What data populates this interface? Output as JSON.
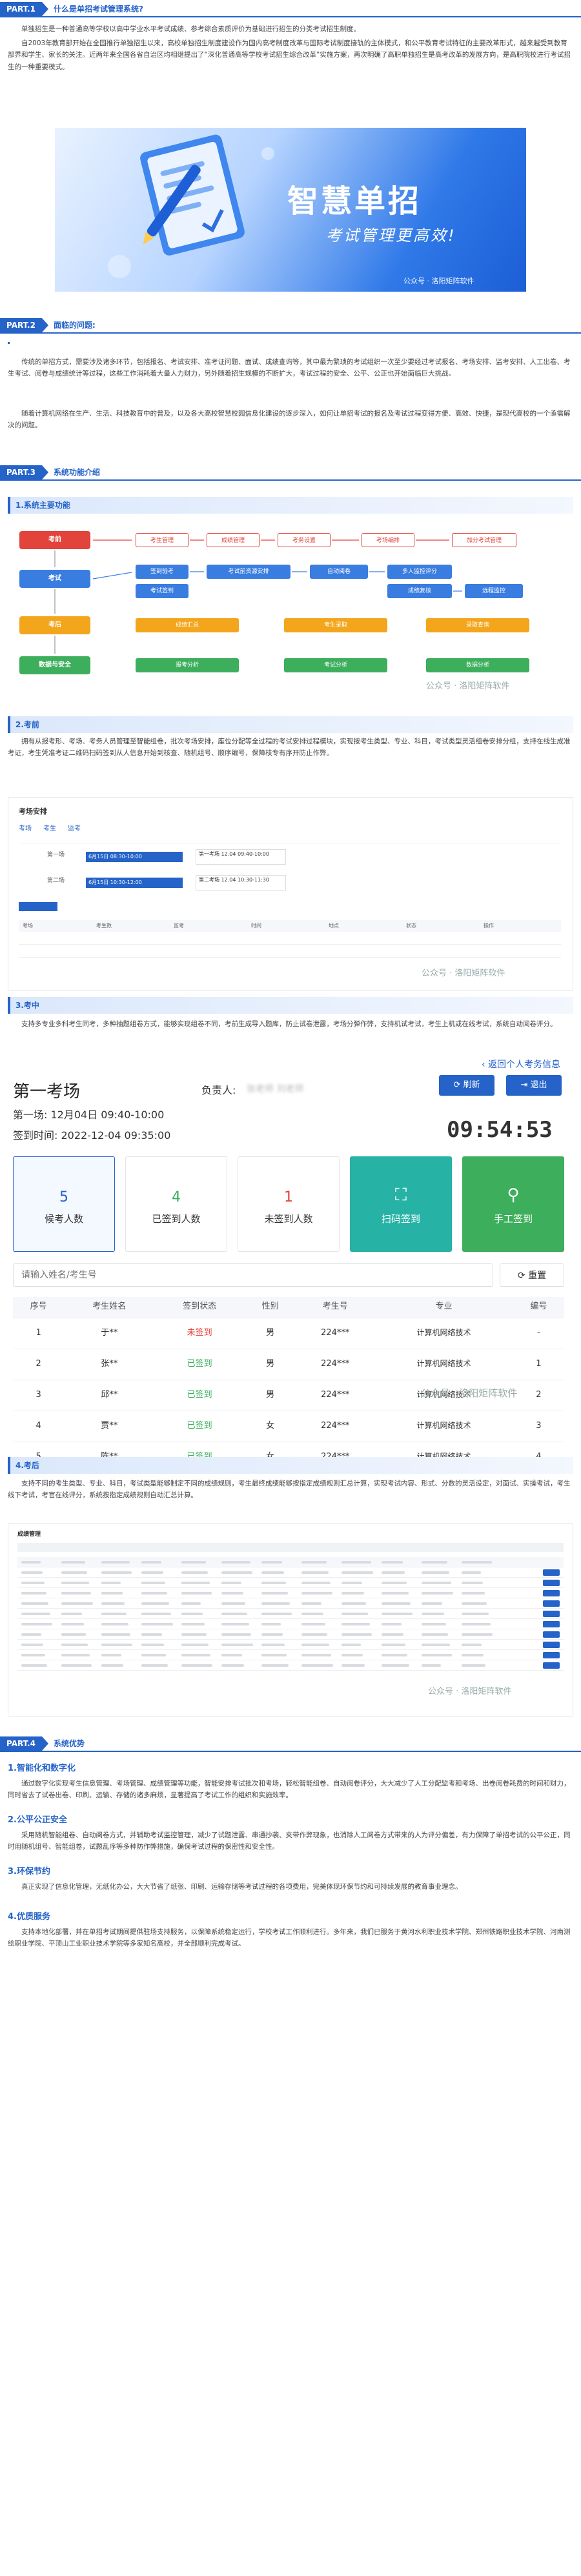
{
  "part1": {
    "tag": "PART.1",
    "title": "什么是单招考试管理系统?"
  },
  "part1_paras": [
    "单独招生是一种普通高等学校以高中学业水平考试成绩、参考综合素质评价为基础进行招生的分类考试招生制度。",
    "自2003年教育部开始在全国推行单独招生以来，高校单独招生制度建设作为国内高考制度改革与国际考试制度接轨的主体模式，和公平教育考试特征的主要改革形式，越来越受到教育部界和学生、家长的关注。近两年来全国各省自治区均相继提出了“深化普通高等学校考试招生综合改革”实施方案，再次明确了高职单独招生是高考改革的发展方向，是高职院校进行考试招生的一种重要模式。"
  ],
  "banner": {
    "title": "智慧单招",
    "subtitle": "考试管理更高效!",
    "watermark": "公众号 · 洛阳矩阵软件"
  },
  "part2": {
    "tag": "PART.2",
    "title": "面临的问题:"
  },
  "part2_paras": [
    "传统的单招方式，需要涉及诸多环节，包括报名、考试安排、准考证问题、面试、成绩查询等，其中最为繁琐的考试组织一次至少要经过考试报名、考场安排、监考安排、人工出卷、考生考试、阅卷与成绩统计等过程，这些工作消耗着大量人力财力，另外随着招生规模的不断扩大，考试过程的安全、公平、公正也开始面临巨大挑战。",
    "随着计算机网络在生产、生活、科技教育中的普及，以及各大高校智慧校园信息化建设的逐步深入，如何让单招考试的报名及考试过程变得方便、高效、快捷，是现代高校的一个亟需解决的问题。"
  ],
  "part3": {
    "tag": "PART.3",
    "title": "系统功能介绍"
  },
  "sec1": "1.系统主要功能",
  "flow": {
    "row1": {
      "stage": "考前",
      "items": [
        "考生管理",
        "成绩管理",
        "考务设置",
        "考场编排",
        "加分考试管理"
      ]
    },
    "row2": {
      "stage": "考试",
      "items": [
        "签到验考",
        "考试前资源安排",
        "自动阅卷",
        "多人监控评分"
      ]
    },
    "row2b": {
      "items": [
        "考试签到",
        "成绩复核",
        "远程监控"
      ]
    },
    "row3": {
      "stage": "考后",
      "items": [
        "成绩汇总",
        "考生录取",
        "录取查询"
      ]
    },
    "row4": {
      "stage": "数据与安全",
      "items": [
        "报考分析",
        "考试分析",
        "数据分析"
      ]
    },
    "watermark": "公众号 · 洛阳矩阵软件"
  },
  "sec2": "2.考前",
  "sec2_para": "拥有从报考形、考场、考务人员管理至智能组卷，批次考场安排，座位分配等全过程的考试安排过程模块，实现按考生类型、专业、科目，考试类型灵活组卷安排分组，支持在线生成准考证，考生凭准考证二维码扫码签到从人信息开始到核查、随机组号、顺序编号，保障核专有序开防止作弊。",
  "shot1": {
    "title": "考场安排",
    "tabs": [
      "考场",
      "考生",
      "监考"
    ],
    "rows": [
      {
        "label": "第一场",
        "range": "6月15日 08:30-10:00",
        "info": "第一考场 12.04 09:40-10:00"
      },
      {
        "label": "第二场",
        "range": "6月15日 10:30-12:00",
        "info": "第二考场 12.04 10:30-11:30"
      }
    ],
    "cols": [
      "考场",
      "考生数",
      "监考",
      "时间",
      "地点",
      "状态",
      "操作"
    ],
    "watermark": "公众号 · 洛阳矩阵软件"
  },
  "sec3": "3.考中",
  "sec3_para": "支持多专业多科考生同考，多种抽题组卷方式，能够实现组卷不同，考前生成导入题库，防止试卷泄露，考场分弹作弊，支持机试考试，考生上机或在线考试，系统自动阅卷评分。",
  "exam": {
    "back_link": "返回个人考务信息",
    "room": "第一考场",
    "supervisor_label": "负责人:",
    "supervisor": "张老师 刘老师",
    "session": "第一场: 12月04日 09:40-10:00",
    "signin_time": "签到时间: 2022-12-04 09:35:00",
    "refresh": "刷新",
    "logout": "退出",
    "clock": "09:54:53",
    "stats": [
      {
        "num": "5",
        "label": "候考人数"
      },
      {
        "num": "4",
        "label": "已签到人数"
      },
      {
        "num": "1",
        "label": "未签到人数"
      }
    ],
    "scan_btn": "扫码签到",
    "manual_btn": "手工签到",
    "search_placeholder": "请输入姓名/考生号",
    "reset": "重置",
    "headers": [
      "序号",
      "考生姓名",
      "签到状态",
      "性别",
      "考生号",
      "专业",
      "编号"
    ],
    "rows": [
      {
        "no": "1",
        "name": "于**",
        "status": "未签到",
        "sex": "男",
        "id": "224***",
        "major": "计算机网络技术",
        "code": "-"
      },
      {
        "no": "2",
        "name": "张**",
        "status": "已签到",
        "sex": "男",
        "id": "224***",
        "major": "计算机网络技术",
        "code": "1"
      },
      {
        "no": "3",
        "name": "邱**",
        "status": "已签到",
        "sex": "男",
        "id": "224***",
        "major": "计算机网络技术",
        "code": "2"
      },
      {
        "no": "4",
        "name": "贾**",
        "status": "已签到",
        "sex": "女",
        "id": "224***",
        "major": "计算机网络技术",
        "code": "3"
      },
      {
        "no": "5",
        "name": "陈**",
        "status": "已签到",
        "sex": "女",
        "id": "224***",
        "major": "计算机网络技术",
        "code": "4"
      }
    ],
    "watermark": "公众号 · 洛阳矩阵软件"
  },
  "sec4": "4.考后",
  "sec4_para": "支持不同的考生类型、专业、科目，考试类型能够制定不同的成绩规则，考生最终成绩能够按指定成绩规则汇总计算，实现考试内容、形式、分数的灵活设定，对面试、实操考试，考生线下考试，考官在线评分，系统按指定成绩规则自动汇总计算。",
  "shot2": {
    "title": "成绩管理",
    "watermark": "公众号 · 洛阳矩阵软件"
  },
  "part4": {
    "tag": "PART.4",
    "title": "系统优势"
  },
  "adv": [
    {
      "title": "1.智能化和数字化",
      "text": "通过数字化实现考生信息管理、考场管理、成绩管理等功能，智能安排考试批次和考场，轻松智能组卷、自动阅卷评分，大大减少了人工分配监考和考场、出卷阅卷耗费的时间和财力，同时省去了试卷出卷、印刷、运输、存储的诸多麻烦，显著提高了考试工作的组织和实施效率。"
    },
    {
      "title": "2.公平公正安全",
      "text": "采用随机智能组卷、自动阅卷方式，并辅助考试监控管理，减少了试题泄露、串通抄袭、夹带作弊现象，也消除人工阅卷方式带来的人为评分偏差，有力保障了单招考试的公平公正，同时用随机组号、智能组卷，试题乱序等多种防作弊措施，确保考试过程的保密性和安全性。"
    },
    {
      "title": "3.环保节约",
      "text": "真正实现了信息化管理，无纸化办公，大大节省了纸张、印刷、运输存储等考试过程的各项费用，完美体现环保节约和可持续发展的教育事业理念。"
    },
    {
      "title": "4.优质服务",
      "text": "支持本地化部署，并在单招考试期间提供驻场支持服务，以保障系统稳定运行，学校考试工作顺利进行。多年来，我们已服务于黄河水利职业技术学院、郑州铁路职业技术学院、河南测绘职业学院、平顶山工业职业技术学院等多家知名高校，并全部顺利完成考试。"
    }
  ]
}
